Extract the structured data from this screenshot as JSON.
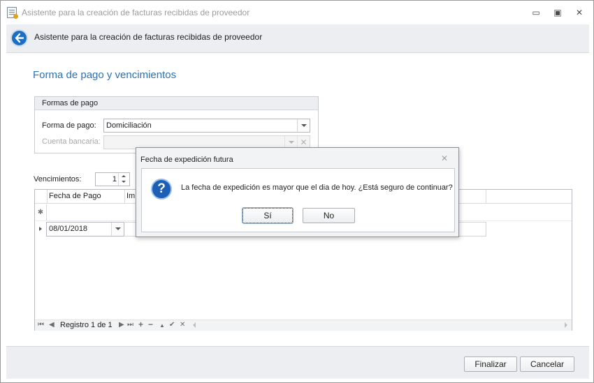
{
  "window": {
    "title": "Asistente para la creación de facturas recibidas de proveedor",
    "controls": {
      "minimize": "▭",
      "restore": "▣",
      "close": "✕"
    }
  },
  "wizard": {
    "header_title": "Asistente para la creación de facturas recibidas de proveedor",
    "section_title": "Forma de pago y vencimientos"
  },
  "payment_group": {
    "title": "Formas de pago",
    "forma_label": "Forma de pago:",
    "forma_value": "Domiciliación",
    "cuenta_label": "Cuenta bancaria:",
    "cuenta_value": ""
  },
  "vencimientos": {
    "label": "Vencimientos:",
    "value": "1"
  },
  "grid": {
    "columns": [
      "Fecha de Pago",
      "Im"
    ],
    "new_row_glyph": "✱",
    "rows": [
      {
        "fecha": "08/01/2018"
      }
    ],
    "navigator": {
      "record_text": "Registro 1 de 1",
      "first": "⏮",
      "prev": "◀",
      "next": "▶",
      "last": "⏭",
      "add": "+",
      "delete": "−",
      "edit": "▲",
      "save": "✔",
      "cancel": "✕"
    }
  },
  "footer": {
    "finish_label": "Finalizar",
    "cancel_label": "Cancelar"
  },
  "dialog": {
    "title": "Fecha de expedición futura",
    "close_glyph": "✕",
    "icon_glyph": "?",
    "message": "La fecha de expedición es mayor que el dia de hoy. ¿Está seguro de continuar?",
    "yes_label": "Sí",
    "no_label": "No"
  },
  "colors": {
    "accent": "#2a72b8",
    "header_bg": "#eceef2",
    "icon_blue": "#1c5fb5"
  }
}
